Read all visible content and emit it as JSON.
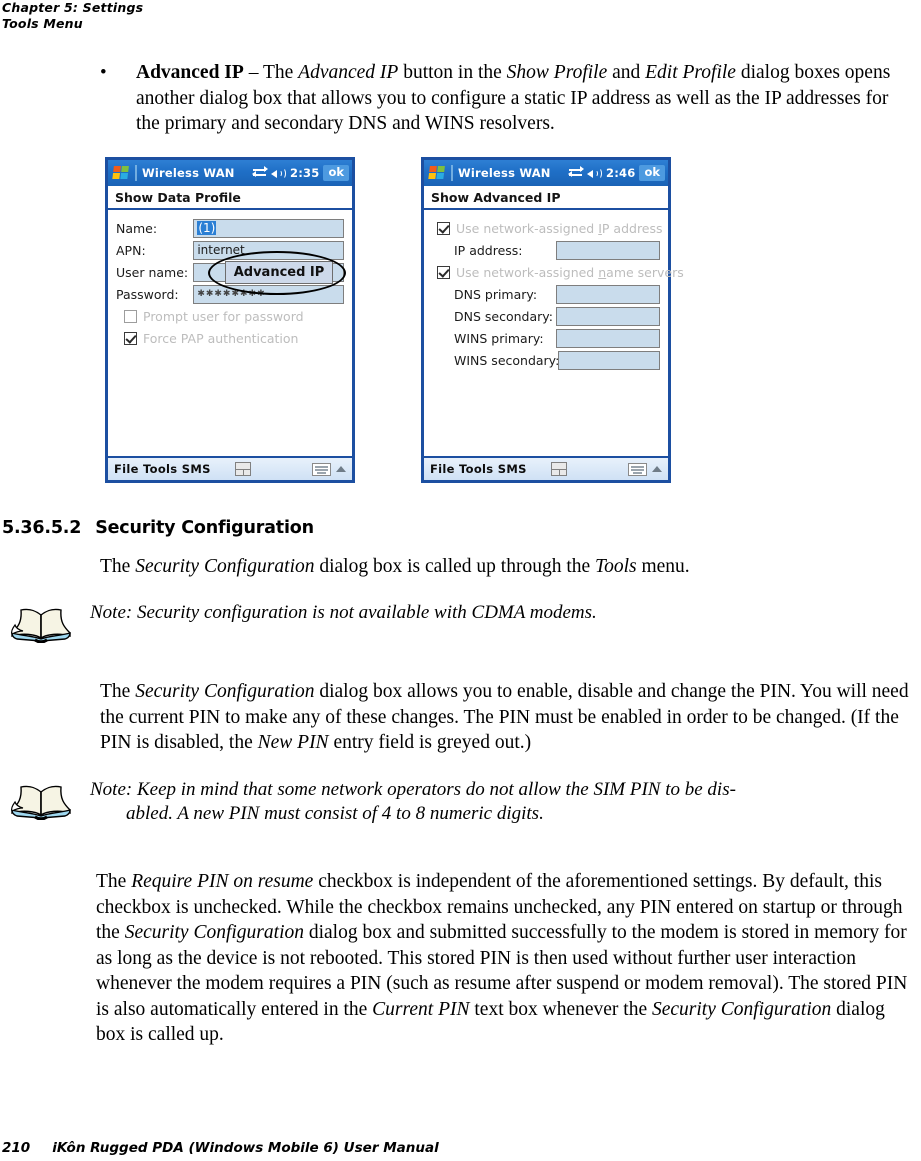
{
  "running_head": {
    "line1": "Chapter 5: Settings",
    "line2": "Tools Menu"
  },
  "bullet": {
    "marker": "•",
    "term": "Advanced IP",
    "dash": " – The ",
    "ref1": "Advanced IP",
    "mid1": " button in the ",
    "ref2": "Show Profile",
    "mid2": " and ",
    "ref3": "Edit Profile",
    "tail": " dialog boxes opens another dialog box that allows you to configure a static IP address as well as the IP addresses for the primary and secondary DNS and WINS resolvers."
  },
  "pda_left": {
    "titlebar": {
      "app_title": "Wireless WAN",
      "clock": "2:35",
      "ok_label": "ok",
      "start_icon": "windows-flag-icon",
      "connectivity_icon": "connectivity-icon",
      "volume_icon": "speaker-icon"
    },
    "dialog_title": "Show Data Profile",
    "fields": [
      {
        "label": "Name:",
        "value": "(1)",
        "selected": true
      },
      {
        "label": "APN:",
        "value": "internet",
        "selected": false
      },
      {
        "label": "User name:",
        "value": "",
        "selected": false
      },
      {
        "label": "Password:",
        "value": "✱✱✱✱✱✱✱✱",
        "selected": false
      }
    ],
    "checkboxes": [
      {
        "label": "Prompt user for password",
        "accel": "P",
        "checked": false,
        "disabled": true
      },
      {
        "label": "Force PAP authentication",
        "accel": "F",
        "checked": true,
        "disabled": true
      }
    ],
    "button": {
      "label": "Advanced IP",
      "accel": "A",
      "highlight": "ellipse-callout"
    },
    "footer": {
      "menu": "File  Tools  SMS",
      "grid_icon": "grid-icon",
      "keyboard_icon": "keyboard-icon",
      "caret_icon": "caret-up-icon"
    }
  },
  "pda_right": {
    "titlebar": {
      "app_title": "Wireless WAN",
      "clock": "2:46",
      "ok_label": "ok",
      "start_icon": "windows-flag-icon",
      "connectivity_icon": "connectivity-icon",
      "volume_icon": "speaker-icon"
    },
    "dialog_title": "Show Advanced IP",
    "checkbox_ip": {
      "label_a": "Use network-assigned ",
      "accel": "I",
      "label_b": "P address",
      "checked": true,
      "disabled": true
    },
    "checkbox_dns": {
      "label_a": "Use network-assigned ",
      "accel": "n",
      "label_b": "ame servers",
      "checked": true,
      "disabled": true
    },
    "fields": [
      {
        "label": "IP address:",
        "value": ""
      },
      {
        "label": "DNS primary:",
        "value": ""
      },
      {
        "label": "DNS secondary:",
        "value": ""
      },
      {
        "label": "WINS primary:",
        "value": ""
      },
      {
        "label": "WINS secondary:",
        "value": ""
      }
    ],
    "footer": {
      "menu": "File  Tools  SMS",
      "grid_icon": "grid-icon",
      "keyboard_icon": "keyboard-icon",
      "caret_icon": "caret-up-icon"
    }
  },
  "section": {
    "number": "5.36.5.2",
    "title": "Security Configuration"
  },
  "paragraphs": {
    "intro_a": "The ",
    "intro_ref": "Security Configuration",
    "intro_b": " dialog box is called up through the ",
    "intro_ref2": "Tools",
    "intro_c": " menu.",
    "body1_a": "The ",
    "body1_ref": "Security Configuration",
    "body1_b": " dialog box allows you to enable, disable and change the PIN. You will need the current PIN to make any of these changes. The PIN must be enabled in order to be changed. (If the PIN is disabled, the ",
    "body1_ref2": "New PIN",
    "body1_c": " entry field is greyed out.)",
    "body2_a": "The ",
    "body2_ref": "Require PIN on resume",
    "body2_b": " checkbox is independent of the aforementioned settings. By default, this checkbox is unchecked. While the checkbox remains unchecked, any PIN entered on startup or through the ",
    "body2_ref2": "Security Configuration",
    "body2_c": " dialog box and submitted successfully to the modem is stored in memory for as long as the device is not rebooted. This stored PIN is then used without further user interaction whenever the modem requires a PIN (such as resume after suspend or modem removal). The stored PIN is also automatically entered in the ",
    "body2_ref3": "Current PIN",
    "body2_d": " text box whenever the ",
    "body2_ref4": "Security Configuration",
    "body2_e": " dialog box is called up."
  },
  "notes": [
    {
      "icon": "open-book-icon",
      "line1": "Note: Security configuration is not available with CDMA modems.",
      "line2": ""
    },
    {
      "icon": "open-book-icon",
      "line1": "Note: Keep in mind that some network operators do not allow the SIM PIN to be dis-",
      "line2": "abled. A new PIN must consist of 4 to 8 numeric digits."
    }
  ],
  "page_footer": {
    "page_number": "210",
    "manual_title": "iKôn Rugged PDA (Windows Mobile 6) User Manual"
  },
  "colors": {
    "titlebar_blue": "#1f6fc6",
    "frame_blue": "#1c4fa1",
    "field_fill": "#c9dcec",
    "selection_blue": "#2b7fd4",
    "button_face": "#cdd9ea",
    "disabled_text": "#bdbdbd",
    "footer_gradient_top": "#e8f1fb"
  }
}
